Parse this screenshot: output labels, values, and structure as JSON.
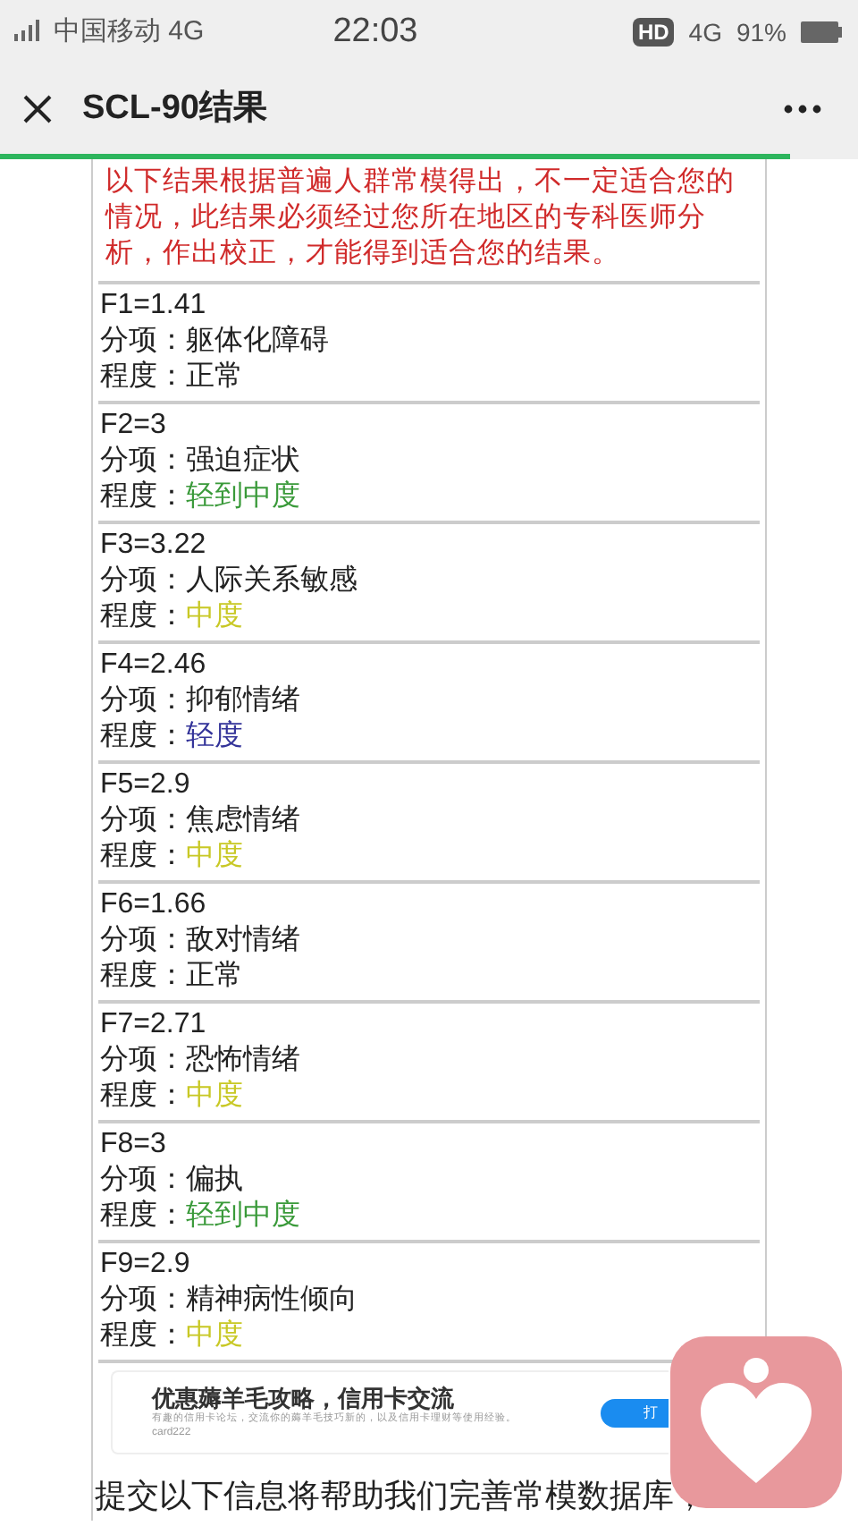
{
  "status_bar": {
    "carrier": "中国移动 4G",
    "time": "22:03",
    "hd": "HD",
    "network": "4G",
    "battery": "91%"
  },
  "title_bar": {
    "title": "SCL-90结果",
    "progress": {
      "level": 0.92
    }
  },
  "notice": "以下结果根据普遍人群常模得出，不一定适合您的情况，此结果必须经过您所在地区的专科医师分析，作出校正，才能得到适合您的结果。",
  "results": [
    {
      "score": "F1=1.41",
      "factor_label": "分项：",
      "factor": "躯体化障碍",
      "degree_label": "程度：",
      "degree": "正常",
      "color": "#222222"
    },
    {
      "score": "F2=3",
      "factor_label": "分项：",
      "factor": "强迫症状",
      "degree_label": "程度：",
      "degree": "轻到中度",
      "color": "#3a9a3a"
    },
    {
      "score": "F3=3.22",
      "factor_label": "分项：",
      "factor": "人际关系敏感",
      "degree_label": "程度：",
      "degree": "中度",
      "color": "#c8c825"
    },
    {
      "score": "F4=2.46",
      "factor_label": "分项：",
      "factor": "抑郁情绪",
      "degree_label": "程度：",
      "degree": "轻度",
      "color": "#333399"
    },
    {
      "score": "F5=2.9",
      "factor_label": "分项：",
      "factor": "焦虑情绪",
      "degree_label": "程度：",
      "degree": "中度",
      "color": "#c8c825"
    },
    {
      "score": "F6=1.66",
      "factor_label": "分项：",
      "factor": "敌对情绪",
      "degree_label": "程度：",
      "degree": "正常",
      "color": "#222222"
    },
    {
      "score": "F7=2.71",
      "factor_label": "分项：",
      "factor": "恐怖情绪",
      "degree_label": "程度：",
      "degree": "中度",
      "color": "#c8c825"
    },
    {
      "score": "F8=3",
      "factor_label": "分项：",
      "factor": "偏执",
      "degree_label": "程度：",
      "degree": "轻到中度",
      "color": "#3a9a3a"
    },
    {
      "score": "F9=2.9",
      "factor_label": "分项：",
      "factor": "精神病性倾向",
      "degree_label": "程度：",
      "degree": "中度",
      "color": "#c8c825"
    }
  ],
  "ad": {
    "title": "优惠薅羊毛攻略，信用卡交流",
    "description": "有趣的信用卡论坛，交流你的薅羊毛技巧新的，以及信用卡理财等使用经验。",
    "account": "card222",
    "button": "打"
  },
  "footer_text": "提交以下信息将帮助我们完善常模数据库，"
}
